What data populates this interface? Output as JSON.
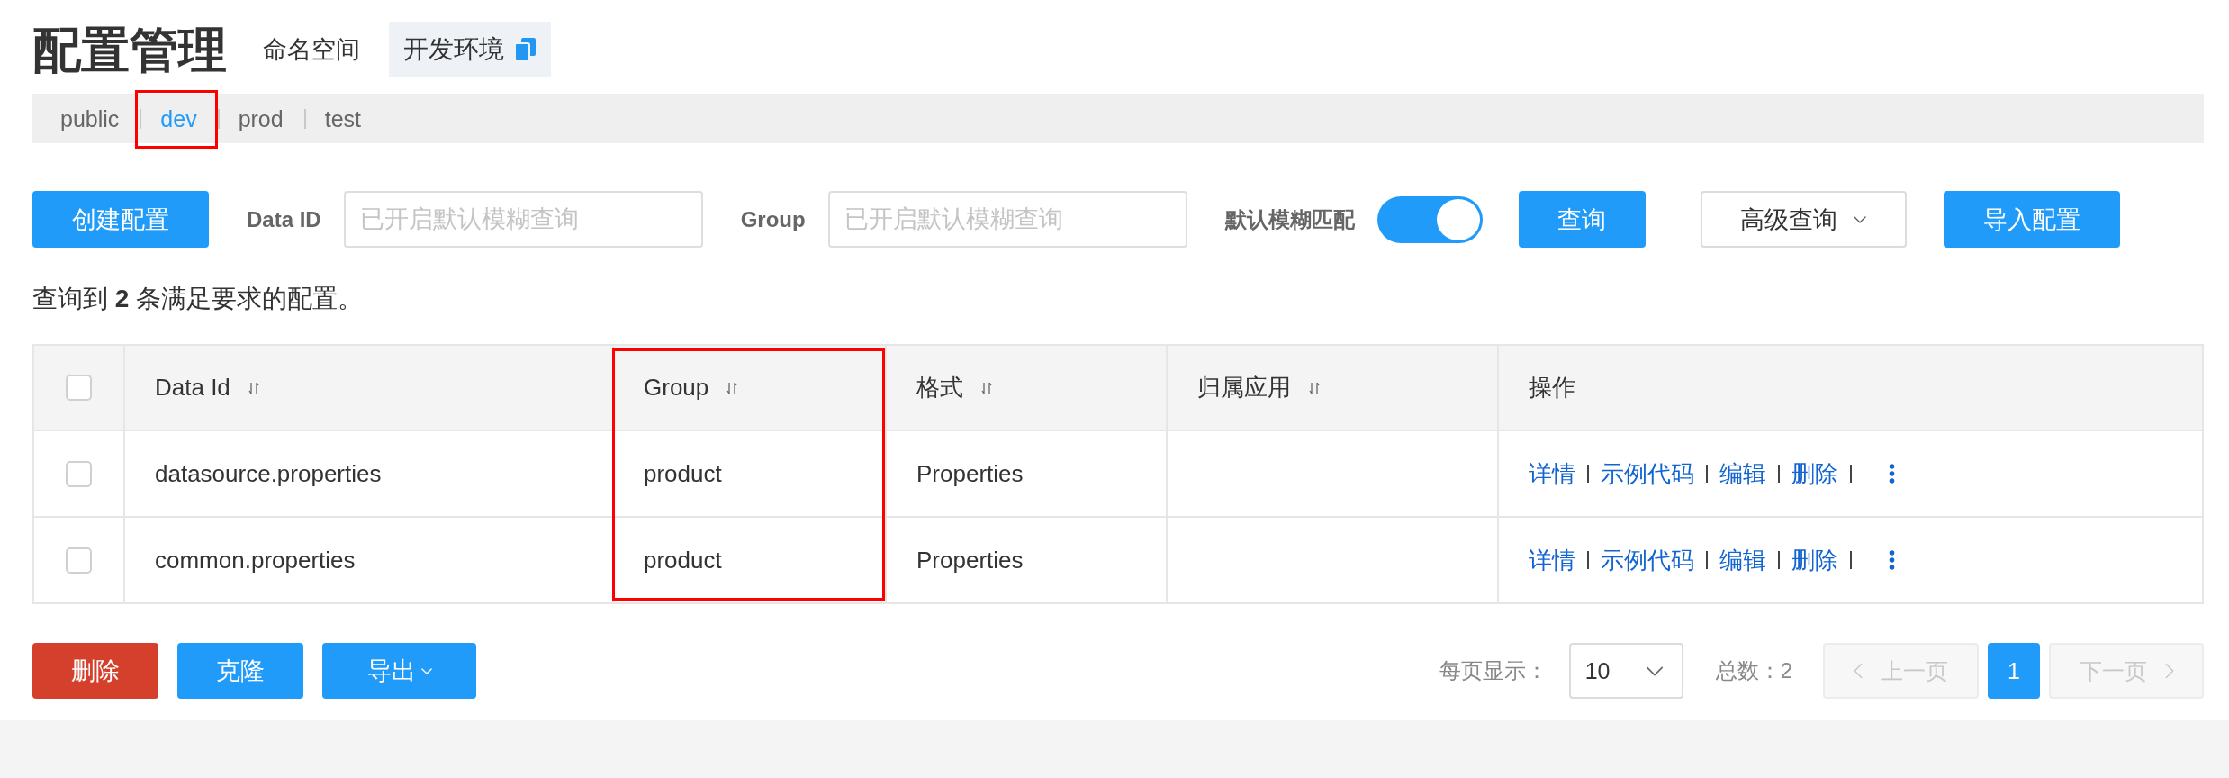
{
  "header": {
    "title": "配置管理",
    "namespace_label": "命名空间",
    "current_namespace": "开发环境"
  },
  "namespaces": [
    {
      "label": "public",
      "selected": false,
      "highlighted": false
    },
    {
      "label": "dev",
      "selected": true,
      "highlighted": true
    },
    {
      "label": "prod",
      "selected": false,
      "highlighted": false
    },
    {
      "label": "test",
      "selected": false,
      "highlighted": false
    }
  ],
  "toolbar": {
    "create_button": "创建配置",
    "fields": [
      {
        "label": "Data ID",
        "placeholder": "已开启默认模糊查询"
      },
      {
        "label": "Group",
        "placeholder": "已开启默认模糊查询"
      }
    ],
    "fuzzy_match": {
      "label": "默认模糊匹配",
      "on": true
    },
    "search_button": "查询",
    "advanced_search": "高级查询",
    "import_button": "导入配置"
  },
  "summary": "查询到 **2** 条满足要求的配置。",
  "table": {
    "select_all": {
      "checked": false
    },
    "columns": [
      {
        "label": "Data Id",
        "sortable": true,
        "highlighted": false
      },
      {
        "label": "Group",
        "sortable": true,
        "highlighted": true
      },
      {
        "label": "格式",
        "sortable": true,
        "highlighted": false
      },
      {
        "label": "归属应用",
        "sortable": true,
        "highlighted": false
      },
      {
        "label": "操作",
        "sortable": false,
        "highlighted": false
      }
    ],
    "rows": [
      {
        "checked": false,
        "data_id": "datasource.properties",
        "group": "product",
        "format": "Properties",
        "actions": [
          "详情",
          "示例代码",
          "编辑",
          "删除"
        ]
      },
      {
        "checked": false,
        "data_id": "common.properties",
        "group": "product",
        "format": "Properties",
        "actions": [
          "详情",
          "示例代码",
          "编辑",
          "删除"
        ]
      }
    ]
  },
  "footer": {
    "buttons": [
      {
        "label": "删除",
        "kind": "danger",
        "menu": false
      },
      {
        "label": "克隆",
        "kind": "primary",
        "menu": false
      },
      {
        "label": "导出",
        "kind": "primary",
        "menu": true
      }
    ],
    "pagination": {
      "page_size_label": "每页显示：",
      "page_size": "10",
      "total": "总数：2",
      "previous": {
        "label": "上一页",
        "disabled": true
      },
      "pages": [
        {
          "label": "1",
          "selected": true
        }
      ],
      "next": {
        "label": "下一页",
        "disabled": true
      }
    }
  }
}
